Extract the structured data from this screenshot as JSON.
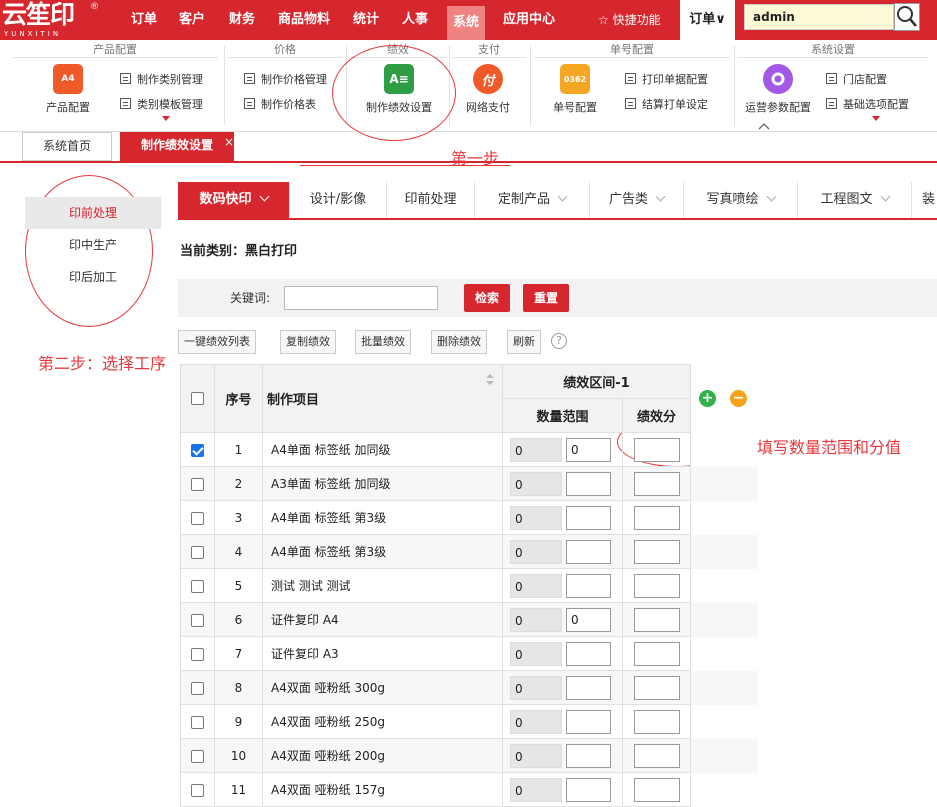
{
  "app": {
    "logo_text": "云笙印",
    "logo_sub": "YUNXITIN",
    "logo_reg": "®"
  },
  "topnav": {
    "items": [
      "订单",
      "客户",
      "财务",
      "商品物料",
      "统计",
      "人事",
      "系统",
      "应用中心"
    ],
    "active": "系统",
    "quick": "☆ 快捷功能",
    "order_select": "订单∨",
    "search_value": "admin"
  },
  "ribbon": {
    "groups": [
      "产品配置",
      "价格",
      "绩效",
      "支付",
      "单号配置",
      "系统设置"
    ],
    "product_config": "产品配置",
    "cat_manage": "制作类别管理",
    "cat_template": "类别模板管理",
    "price_manage": "制作价格管理",
    "price_table": "制作价格表",
    "perf_setting": "制作绩效设置",
    "net_pay": "网络支付",
    "net_pay_icon": "付",
    "order_no_config": "单号配置",
    "order_no_icon": "0362",
    "print_doc_config": "打印单据配置",
    "settle_print": "结算打单设定",
    "ops_params": "运营参数配置",
    "store_config": "门店配置",
    "base_options": "基础选项配置",
    "perf_icon": "A≡",
    "prod_icon": "A4"
  },
  "tabs": {
    "home": "系统首页",
    "current": "制作绩效设置",
    "close": "×"
  },
  "annotations": {
    "step1": "第一步",
    "step2": "第二步：选择工序",
    "step3": "填写数量范围和分值"
  },
  "leftnav": {
    "items": [
      "印前处理",
      "印中生产",
      "印后加工"
    ]
  },
  "categories": {
    "tabs": [
      "数码快印",
      "设计/影像",
      "印前处理",
      "定制产品",
      "广告类",
      "写真喷绘",
      "工程图文",
      "装"
    ]
  },
  "current_category": "当前类别：黑白打印",
  "search": {
    "keyword_label": "关键词:",
    "keyword_value": "",
    "search_btn": "检索",
    "reset_btn": "重置"
  },
  "toolbar": {
    "one_click": "一键绩效列表",
    "copy": "复制绩效",
    "batch": "批量绩效",
    "delete": "删除绩效",
    "refresh": "刷新",
    "help": "?"
  },
  "table": {
    "col_seq": "序号",
    "col_item": "制作项目",
    "col_interval": "绩效区间-1",
    "col_qty": "数量范围",
    "col_score": "绩效分",
    "add": "+",
    "remove": "−",
    "rows": [
      {
        "seq": "1",
        "name": "A4单面 标签纸 加同级",
        "from": "0",
        "to": "0",
        "checked": true
      },
      {
        "seq": "2",
        "name": "A3单面 标签纸 加同级",
        "from": "0",
        "to": "",
        "checked": false
      },
      {
        "seq": "3",
        "name": "A4单面 标签纸 第3级",
        "from": "0",
        "to": "",
        "checked": false
      },
      {
        "seq": "4",
        "name": "A4单面 标签纸 第3级",
        "from": "0",
        "to": "",
        "checked": false
      },
      {
        "seq": "5",
        "name": "测试 测试 测试",
        "from": "0",
        "to": "",
        "checked": false
      },
      {
        "seq": "6",
        "name": "证件复印 A4",
        "from": "0",
        "to": "0",
        "checked": false
      },
      {
        "seq": "7",
        "name": "证件复印 A3",
        "from": "0",
        "to": "",
        "checked": false
      },
      {
        "seq": "8",
        "name": "A4双面 哑粉纸 300g",
        "from": "0",
        "to": "",
        "checked": false
      },
      {
        "seq": "9",
        "name": "A4双面 哑粉纸 250g",
        "from": "0",
        "to": "",
        "checked": false
      },
      {
        "seq": "10",
        "name": "A4双面 哑粉纸 200g",
        "from": "0",
        "to": "",
        "checked": false
      },
      {
        "seq": "11",
        "name": "A4双面 哑粉纸 157g",
        "from": "0",
        "to": "",
        "checked": false
      }
    ]
  },
  "colors": {
    "brand_red": "#d6262e",
    "annotation_red": "#e8383d"
  }
}
